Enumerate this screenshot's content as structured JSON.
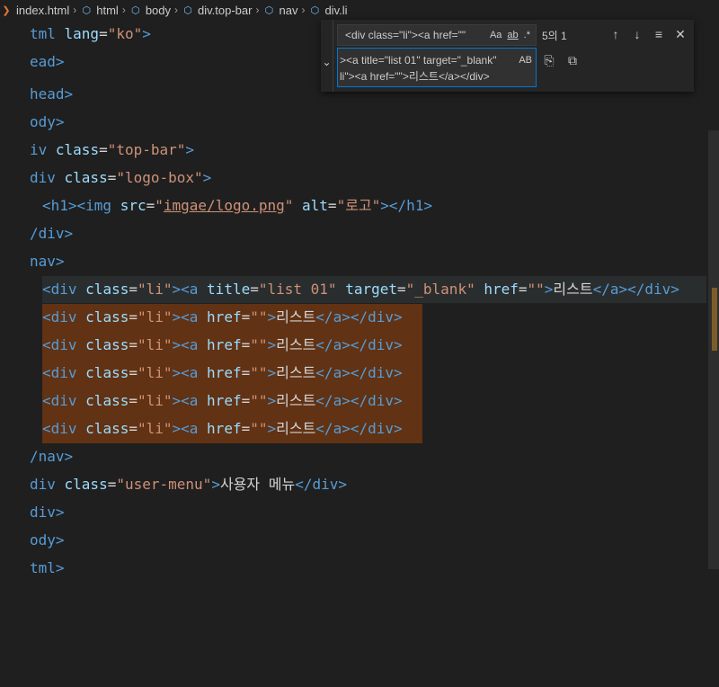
{
  "breadcrumb": {
    "items": [
      "index.html",
      "html",
      "body",
      "div.top-bar",
      "nav",
      "div.li"
    ]
  },
  "find": {
    "query": "<div class=\"li\"><a href=\"\"",
    "match_case": "Aa",
    "whole_word": "ab",
    "regex": ".*",
    "count": "5의 1",
    "replace_line1": "><a title=\"list 01\" target=\"_blank\"",
    "replace_line2": "li\"><a href=\"\">리스트</a></div>",
    "preserve_case": "AB"
  },
  "code": {
    "l1": [
      "tml ",
      "lang",
      "=",
      "\"ko\"",
      ">"
    ],
    "l2": [
      "ead>"
    ],
    "l3": [
      "head>"
    ],
    "l4": [
      "ody>"
    ],
    "l5": [
      "iv ",
      "class",
      "=",
      "\"top-bar\"",
      ">"
    ],
    "l6": [
      "div ",
      "class",
      "=",
      "\"logo-box\"",
      ">"
    ],
    "l7": [
      "<h1><img ",
      "src",
      "=",
      "\"",
      "imgae/logo.png",
      "\"",
      " alt",
      "=",
      "\"로고\"",
      "></h1>"
    ],
    "l8": [
      "/div>"
    ],
    "l9": [
      "nav>"
    ],
    "l10": [
      "<div ",
      "class",
      "=",
      "\"li\"",
      "><a ",
      "title",
      "=",
      "\"list 01\"",
      " target",
      "=",
      "\"_blank\"",
      " href",
      "=",
      "\"\"",
      ">",
      "리스트",
      "</a></div>"
    ],
    "match": [
      "<div ",
      "class",
      "=",
      "\"li\"",
      "><a ",
      "href",
      "=",
      "\"\"",
      ">",
      "리스트",
      "</a></div>"
    ],
    "l16": [
      "/nav>"
    ],
    "l17": [
      "div ",
      "class",
      "=",
      "\"user-menu\"",
      ">",
      "사용자 메뉴",
      "</div>"
    ],
    "l18": [
      "div>"
    ],
    "l19": [
      "ody>"
    ],
    "l20": [
      "tml>"
    ]
  }
}
